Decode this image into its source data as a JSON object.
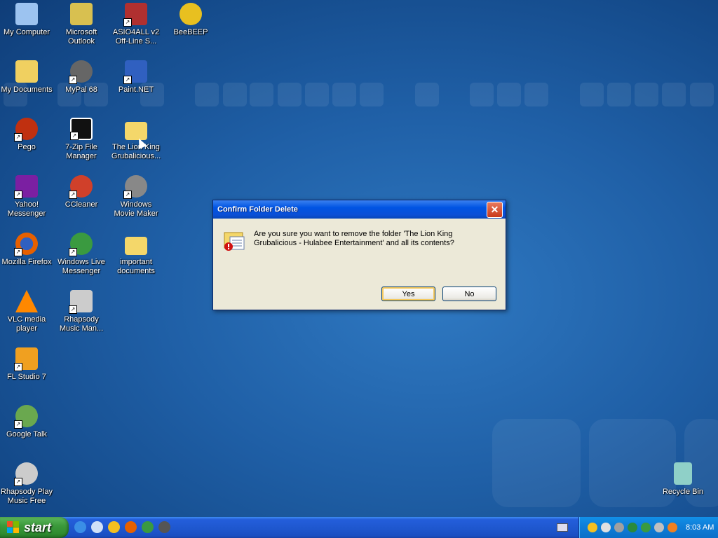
{
  "desktop": {
    "icons": [
      {
        "label": "My Computer",
        "icon": "my-computer-icon",
        "color": "#9cc3f0"
      },
      {
        "label": "Microsoft Outlook",
        "icon": "outlook-icon",
        "color": "#d8c050"
      },
      {
        "label": "ASIO4ALL v2 Off-Line S...",
        "icon": "asio4all-icon",
        "color": "#b03030"
      },
      {
        "label": "BeeBEEP",
        "icon": "beebeep-icon",
        "color": "#e8c020"
      },
      {
        "label": "My Documents",
        "icon": "my-documents-icon",
        "color": "#f0d060"
      },
      {
        "label": "MyPal 68",
        "icon": "mypal-icon",
        "color": "#666666"
      },
      {
        "label": "Paint.NET",
        "icon": "paint-net-icon",
        "color": "#3060c0"
      },
      {
        "label": "Pego",
        "icon": "pego-icon",
        "color": "#c03010"
      },
      {
        "label": "7-Zip File Manager",
        "icon": "seven-zip-icon",
        "color": "#111111"
      },
      {
        "label": "The Lion King Grubalicious...",
        "icon": "folder-icon",
        "color": "#f4d76a"
      },
      {
        "label": "Yahoo! Messenger",
        "icon": "yahoo-messenger-icon",
        "color": "#7b1fa2"
      },
      {
        "label": "CCleaner",
        "icon": "ccleaner-icon",
        "color": "#d0402a"
      },
      {
        "label": "Windows Movie Maker",
        "icon": "movie-maker-icon",
        "color": "#888888"
      },
      {
        "label": "Mozilla Firefox",
        "icon": "firefox-icon",
        "color": "#e66000"
      },
      {
        "label": "Windows Live Messenger",
        "icon": "live-messenger-icon",
        "color": "#3a9a40"
      },
      {
        "label": "important documents",
        "icon": "folder-icon",
        "color": "#f4d76a"
      },
      {
        "label": "VLC media player",
        "icon": "vlc-icon",
        "color": "#ff8800"
      },
      {
        "label": "Rhapsody Music Man...",
        "icon": "rhapsody-icon",
        "color": "#cccccc"
      },
      {
        "label": "FL Studio 7",
        "icon": "fl-studio-icon",
        "color": "#f0a020"
      },
      {
        "label": "Google Talk",
        "icon": "google-talk-icon",
        "color": "#6aa84f"
      },
      {
        "label": "Rhapsody Play Music Free",
        "icon": "rhapsody-play-icon",
        "color": "#cccccc"
      },
      {
        "label": "Recycle Bin",
        "icon": "recycle-bin-icon",
        "color": "#8fd0c8"
      }
    ]
  },
  "dialog": {
    "title": "Confirm Folder Delete",
    "close_glyph": "✕",
    "message": "Are you sure you want to remove the folder 'The Lion King Grubalicious - Hulabee Entertainment' and all its contents?",
    "yes_label": "Yes",
    "no_label": "No"
  },
  "taskbar": {
    "start_label": "start",
    "clock": "8:03 AM"
  },
  "colors": {
    "dialog_bg": "#ece9d8",
    "titlebar": "#0054e3",
    "taskbar": "#245edb",
    "start_green": "#3c9a3c"
  }
}
